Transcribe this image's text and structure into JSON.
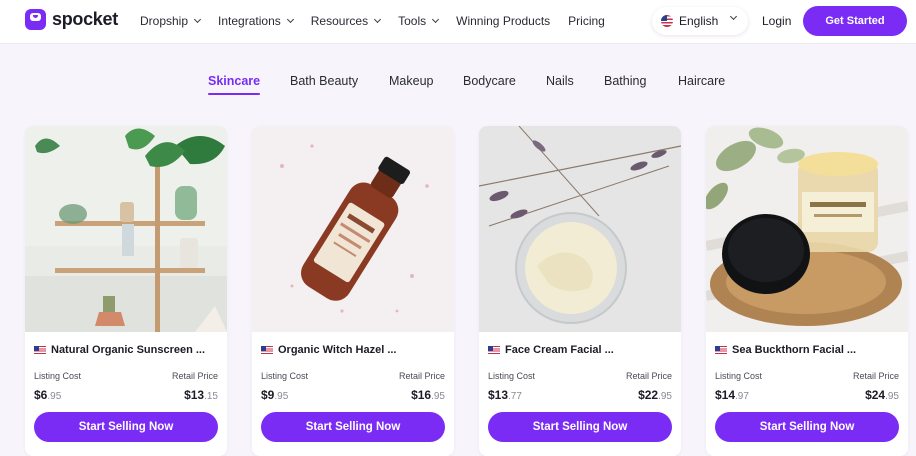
{
  "brand": {
    "name": "spocket",
    "color": "#7a2cf5"
  },
  "nav": {
    "items": [
      {
        "label": "Dropship",
        "dropdown": true
      },
      {
        "label": "Integrations",
        "dropdown": true
      },
      {
        "label": "Resources",
        "dropdown": true
      },
      {
        "label": "Tools",
        "dropdown": true
      },
      {
        "label": "Winning Products",
        "dropdown": false
      },
      {
        "label": "Pricing",
        "dropdown": false
      }
    ],
    "language": "English",
    "login": "Login",
    "cta": "Get Started"
  },
  "tabs": [
    {
      "label": "Skincare",
      "active": true
    },
    {
      "label": "Bath Beauty",
      "active": false
    },
    {
      "label": "Makeup",
      "active": false
    },
    {
      "label": "Bodycare",
      "active": false
    },
    {
      "label": "Nails",
      "active": false
    },
    {
      "label": "Bathing",
      "active": false
    },
    {
      "label": "Haircare",
      "active": false
    }
  ],
  "products": [
    {
      "name": "Natural Organic Sunscreen ...",
      "listing_label": "Listing Cost",
      "retail_label": "Retail Price",
      "cost_main": "$6",
      "cost_cents": ".95",
      "retail_main": "$13",
      "retail_cents": ".15",
      "button": "Start Selling Now",
      "flag": "us-flag-icon"
    },
    {
      "name": "Organic Witch Hazel ...",
      "listing_label": "Listing Cost",
      "retail_label": "Retail Price",
      "cost_main": "$9",
      "cost_cents": ".95",
      "retail_main": "$16",
      "retail_cents": ".95",
      "button": "Start Selling Now",
      "flag": "us-flag-icon"
    },
    {
      "name": "Face Cream Facial ...",
      "listing_label": "Listing Cost",
      "retail_label": "Retail Price",
      "cost_main": "$13",
      "cost_cents": ".77",
      "retail_main": "$22",
      "retail_cents": ".95",
      "button": "Start Selling Now",
      "flag": "us-flag-icon"
    },
    {
      "name": "Sea Buckthorn Facial ...",
      "listing_label": "Listing Cost",
      "retail_label": "Retail Price",
      "cost_main": "$14",
      "cost_cents": ".97",
      "retail_main": "$24",
      "retail_cents": ".95",
      "button": "Start Selling Now",
      "flag": "us-flag-icon"
    }
  ]
}
